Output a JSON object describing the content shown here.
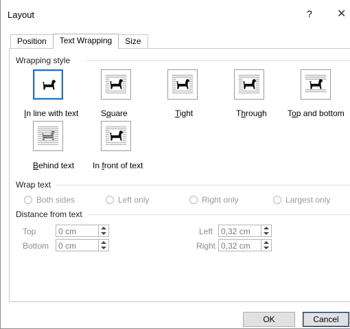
{
  "dialog": {
    "title": "Layout",
    "help": "?",
    "close": "✕"
  },
  "tabs": [
    {
      "label": "Position"
    },
    {
      "label": "Text Wrapping",
      "active": true
    },
    {
      "label": "Size"
    }
  ],
  "wrapping_style": {
    "heading": "Wrapping style",
    "options": [
      {
        "label_pre": "",
        "label_ul": "I",
        "label_post": "n line with text",
        "icon": "inline-icon",
        "selected": true
      },
      {
        "label_pre": "S",
        "label_ul": "q",
        "label_post": "uare",
        "icon": "square-wrap-icon"
      },
      {
        "label_pre": "",
        "label_ul": "T",
        "label_post": "ight",
        "icon": "tight-wrap-icon"
      },
      {
        "label_pre": "T",
        "label_ul": "h",
        "label_post": "rough",
        "icon": "through-wrap-icon"
      },
      {
        "label_pre": "T",
        "label_ul": "o",
        "label_post": "p and bottom",
        "icon": "top-bottom-wrap-icon"
      },
      {
        "label_pre": "",
        "label_ul": "B",
        "label_post": "ehind text",
        "icon": "behind-text-icon"
      },
      {
        "label_pre": "In ",
        "label_ul": "f",
        "label_post": "ront of text",
        "icon": "in-front-of-text-icon"
      }
    ]
  },
  "wrap_text": {
    "heading": "Wrap text",
    "options": [
      "Both sides",
      "Left only",
      "Right only",
      "Largest only"
    ]
  },
  "distance": {
    "heading": "Distance from text",
    "top_label": "Top",
    "top_value": "0 cm",
    "bottom_label": "Bottom",
    "bottom_value": "0 cm",
    "left_label": "Left",
    "left_value": "0,32 cm",
    "right_label": "Right",
    "right_value": "0,32 cm"
  },
  "buttons": {
    "ok": "OK",
    "cancel": "Cancel"
  },
  "colors": {
    "selection": "#2a6ebb",
    "disabled_text": "#9a9a9a"
  }
}
